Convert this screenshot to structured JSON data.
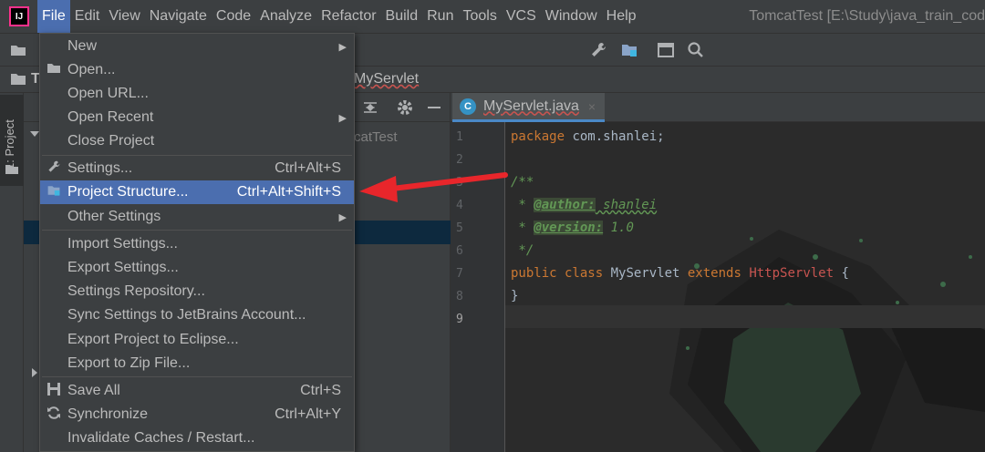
{
  "menubar": {
    "logo": "IJ",
    "items": [
      "File",
      "Edit",
      "View",
      "Navigate",
      "Code",
      "Analyze",
      "Refactor",
      "Build",
      "Run",
      "Tools",
      "VCS",
      "Window",
      "Help"
    ],
    "window_title": "TomcatTest [E:\\Study\\java_train_cod"
  },
  "navbar": {
    "crumb_project": "T",
    "crumb_file": "MyServlet"
  },
  "left_strip": {
    "project_tab": "1: Project"
  },
  "project_panel": {
    "root_label": "catTest"
  },
  "editor": {
    "tab_icon": "C",
    "tab_label": "MyServlet.java",
    "tab_close": "×",
    "line_numbers": [
      "1",
      "2",
      "3",
      "4",
      "5",
      "6",
      "7",
      "8",
      "9"
    ],
    "code": {
      "l1_kw": "package",
      "l1_rest": " com.shanlei;",
      "l3": "/**",
      "l4_star": " * ",
      "l4_tag": "@author:",
      "l4_val": " shanlei",
      "l5_star": " * ",
      "l5_tag": "@version:",
      "l5_val": " 1.0",
      "l6": " */",
      "l7_kw1": "public class",
      "l7_name": " MyServlet ",
      "l7_kw2": "extends",
      "l7_sp": " ",
      "l7_super": "HttpServlet",
      "l7_brace": " {",
      "l8": "}"
    }
  },
  "file_menu": {
    "items": [
      {
        "icon": "",
        "label": "New",
        "shortcut": "",
        "submenu": true
      },
      {
        "icon": "folder-open-icon",
        "label": "Open...",
        "shortcut": "",
        "submenu": false
      },
      {
        "icon": "",
        "label": "Open URL...",
        "shortcut": "",
        "submenu": false
      },
      {
        "icon": "",
        "label": "Open Recent",
        "shortcut": "",
        "submenu": true
      },
      {
        "icon": "",
        "label": "Close Project",
        "shortcut": "",
        "submenu": false
      },
      {
        "icon": "wrench-icon",
        "label": "Settings...",
        "shortcut": "Ctrl+Alt+S",
        "submenu": false
      },
      {
        "icon": "project-structure-icon",
        "label": "Project Structure...",
        "shortcut": "Ctrl+Alt+Shift+S",
        "submenu": false
      },
      {
        "icon": "",
        "label": "Other Settings",
        "shortcut": "",
        "submenu": true
      },
      {
        "icon": "",
        "label": "Import Settings...",
        "shortcut": "",
        "submenu": false
      },
      {
        "icon": "",
        "label": "Export Settings...",
        "shortcut": "",
        "submenu": false
      },
      {
        "icon": "",
        "label": "Settings Repository...",
        "shortcut": "",
        "submenu": false
      },
      {
        "icon": "",
        "label": "Sync Settings to JetBrains Account...",
        "shortcut": "",
        "submenu": false
      },
      {
        "icon": "",
        "label": "Export Project to Eclipse...",
        "shortcut": "",
        "submenu": false
      },
      {
        "icon": "",
        "label": "Export to Zip File...",
        "shortcut": "",
        "submenu": false
      },
      {
        "icon": "save-icon",
        "label": "Save All",
        "shortcut": "Ctrl+S",
        "submenu": false
      },
      {
        "icon": "sync-icon",
        "label": "Synchronize",
        "shortcut": "Ctrl+Alt+Y",
        "submenu": false
      },
      {
        "icon": "",
        "label": "Invalidate Caches / Restart...",
        "shortcut": "",
        "submenu": false
      }
    ],
    "highlighted_index": 6
  },
  "colors": {
    "menu_highlight": "#4b6eaf",
    "arrow": "#e8262b",
    "editor_bg": "#2b2b2b"
  }
}
